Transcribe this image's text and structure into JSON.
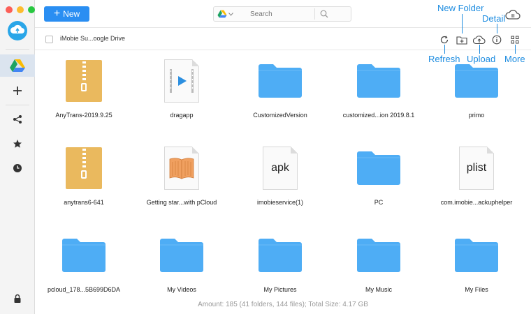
{
  "toolbar": {
    "new_label": "New",
    "search_placeholder": "Search"
  },
  "path": {
    "current": "iMobie Su...oogle Drive"
  },
  "callouts": {
    "new_folder": "New Folder",
    "detail": "Detail",
    "refresh": "Refresh",
    "upload": "Upload",
    "more": "More"
  },
  "items": [
    {
      "name": "AnyTrans-2019.9.25",
      "type": "zip"
    },
    {
      "name": "dragapp",
      "type": "video"
    },
    {
      "name": "CustomizedVersion",
      "type": "folder"
    },
    {
      "name": "customized...ion 2019.8.1",
      "type": "folder"
    },
    {
      "name": "primo",
      "type": "folder"
    },
    {
      "name": "anytrans6-641",
      "type": "zip"
    },
    {
      "name": "Getting star...with pCloud",
      "type": "book"
    },
    {
      "name": "imobieservice(1)",
      "type": "doc",
      "ext": "apk"
    },
    {
      "name": "PC",
      "type": "folder"
    },
    {
      "name": "com.imobie...ackuphelper",
      "type": "doc",
      "ext": "plist"
    },
    {
      "name": "pcloud_178...5B699D6DA",
      "type": "folder"
    },
    {
      "name": "My Videos",
      "type": "folder"
    },
    {
      "name": "My Pictures",
      "type": "folder"
    },
    {
      "name": "My Music",
      "type": "folder"
    },
    {
      "name": "My Files",
      "type": "folder"
    }
  ],
  "status": {
    "summary": "Amount: 185 (41 folders, 144 files); Total Size:  4.17 GB"
  },
  "colors": {
    "accent": "#2a8ef2",
    "folder": "#4eadf5",
    "callout": "#1d8ce0",
    "zip": "#eab95e"
  }
}
